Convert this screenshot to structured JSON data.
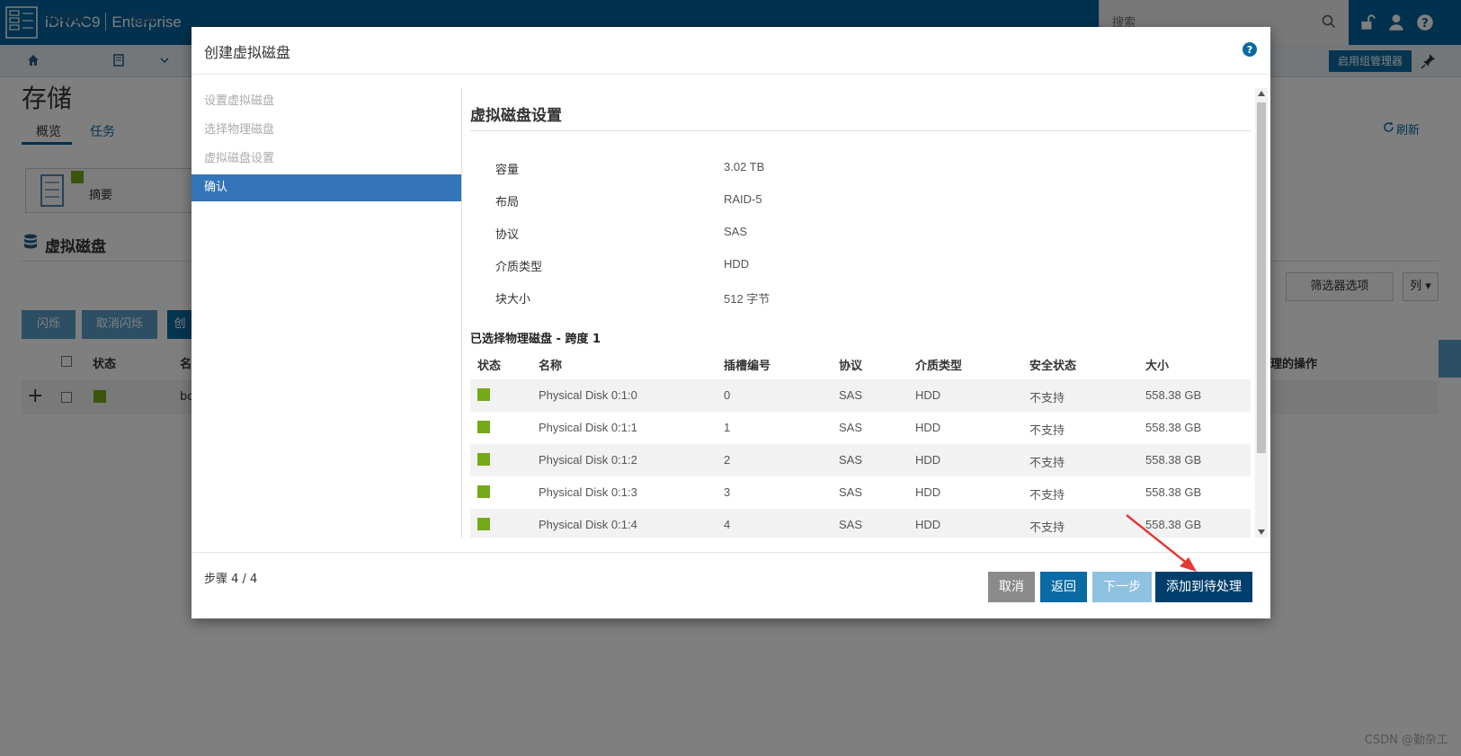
{
  "topbar": {
    "brand_name": "iDRAC9",
    "brand_edition": "Enterprise",
    "search_placeholder": "搜索"
  },
  "subnav": {
    "dashboard": "仪表板",
    "system": "系统",
    "group_manager": "启用组管理器"
  },
  "page": {
    "title": "存储",
    "tab_overview": "概览",
    "tab_tasks": "任务",
    "refresh": "刷新",
    "summary": "摘要",
    "virtual_disk_title": "虚拟磁盘",
    "btn_blink": "闪烁",
    "btn_unblink": "取消闪烁",
    "btn_create_partial": "创",
    "filter_options": "筛选器选项",
    "columns": "列",
    "th_status": "状态",
    "th_name_partial": "名",
    "th_actions_partial": "理的操作",
    "row_name_partial": "bo"
  },
  "modal": {
    "title": "创建虚拟磁盘",
    "steps": [
      "设置虚拟磁盘",
      "选择物理磁盘",
      "虚拟磁盘设置",
      "确认"
    ],
    "active_step": 3,
    "section_title": "虚拟磁盘设置",
    "settings": [
      {
        "label": "容量",
        "value": "3.02 TB"
      },
      {
        "label": "布局",
        "value": "RAID-5"
      },
      {
        "label": "协议",
        "value": "SAS"
      },
      {
        "label": "介质类型",
        "value": "HDD"
      },
      {
        "label": "块大小",
        "value": "512 字节"
      }
    ],
    "span_title": "已选择物理磁盘 - 跨度 1",
    "table_headers": [
      "状态",
      "名称",
      "插槽编号",
      "协议",
      "介质类型",
      "安全状态",
      "大小"
    ],
    "disks": [
      {
        "name": "Physical Disk 0:1:0",
        "slot": "0",
        "protocol": "SAS",
        "media": "HDD",
        "security": "不支持",
        "size": "558.38 GB"
      },
      {
        "name": "Physical Disk 0:1:1",
        "slot": "1",
        "protocol": "SAS",
        "media": "HDD",
        "security": "不支持",
        "size": "558.38 GB"
      },
      {
        "name": "Physical Disk 0:1:2",
        "slot": "2",
        "protocol": "SAS",
        "media": "HDD",
        "security": "不支持",
        "size": "558.38 GB"
      },
      {
        "name": "Physical Disk 0:1:3",
        "slot": "3",
        "protocol": "SAS",
        "media": "HDD",
        "security": "不支持",
        "size": "558.38 GB"
      },
      {
        "name": "Physical Disk 0:1:4",
        "slot": "4",
        "protocol": "SAS",
        "media": "HDD",
        "security": "不支持",
        "size": "558.38 GB"
      }
    ],
    "step_counter": "步骤 4 / 4",
    "buttons": {
      "cancel": "取消",
      "back": "返回",
      "next": "下一步",
      "add_pending": "添加到待处理"
    }
  },
  "colors": {
    "topbar": "#00629d",
    "active_step": "#3474b8",
    "ok_green": "#74a918",
    "primary_btn": "#0a6aa3",
    "dark_btn": "#003e6b",
    "annotation_arrow": "#e53935"
  },
  "watermark": "CSDN @勤杂工"
}
